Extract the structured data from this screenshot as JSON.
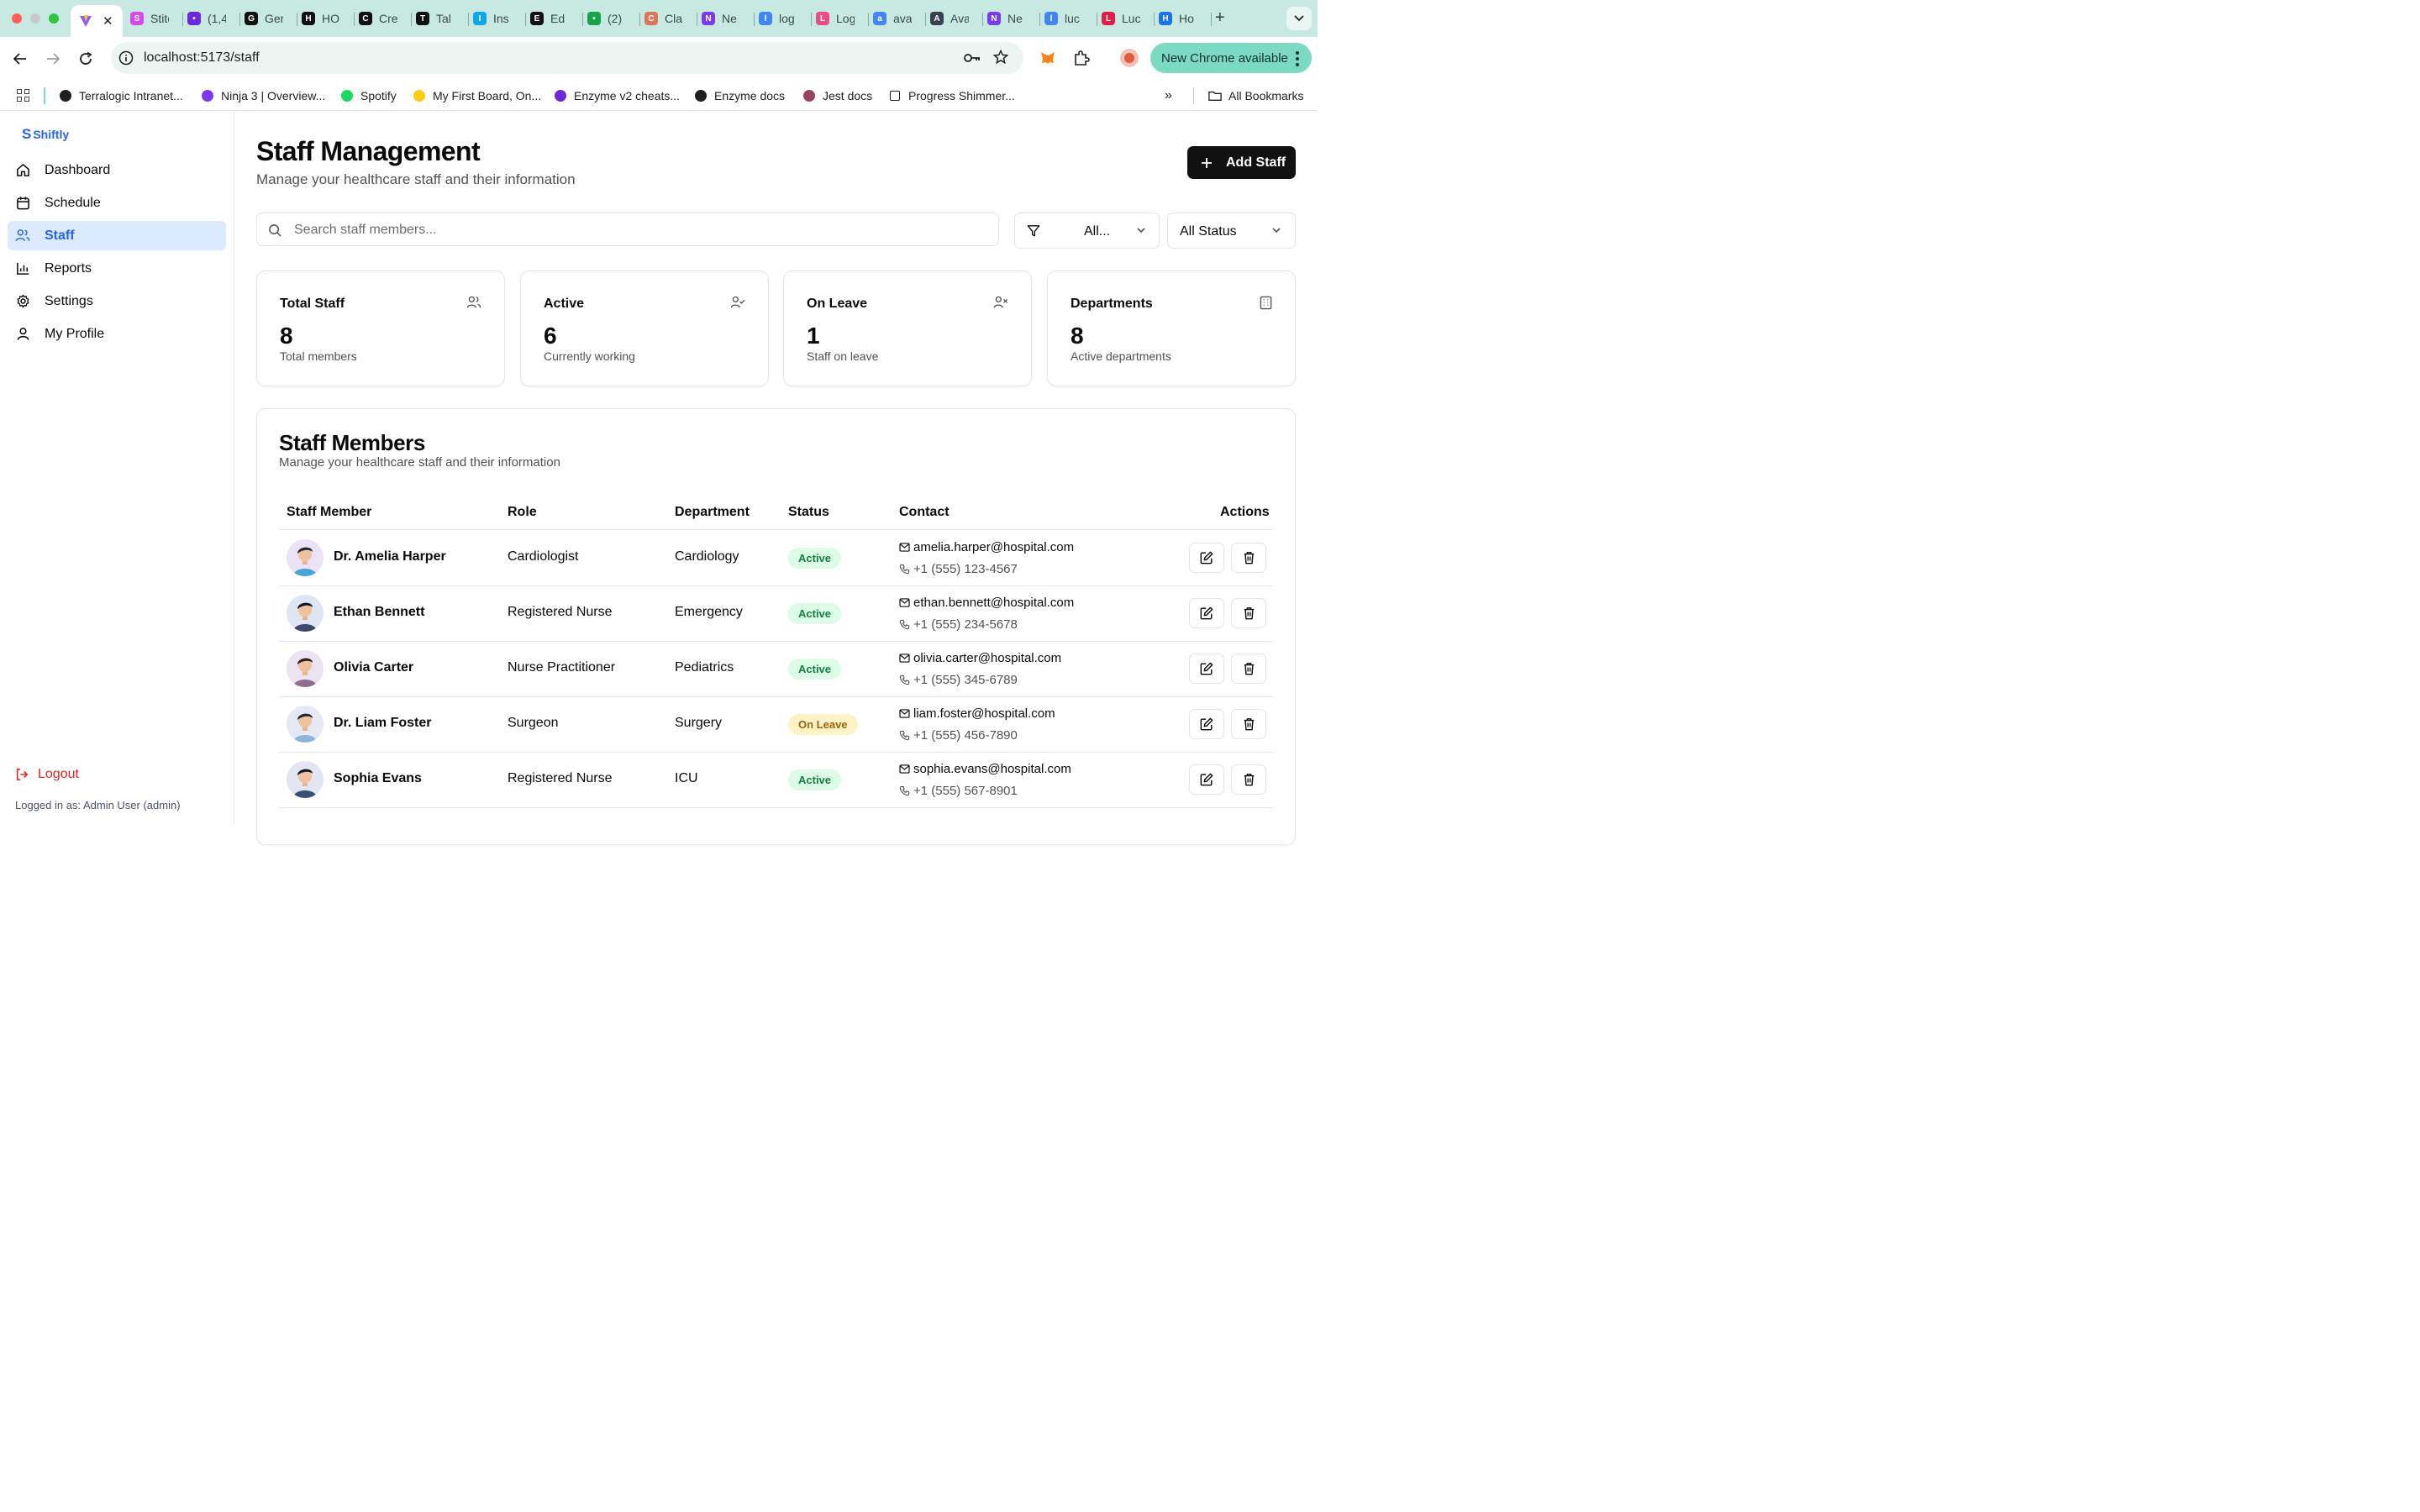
{
  "browser": {
    "tabs": [
      {
        "title": "",
        "icon": "vite-icon",
        "color": "#8b5cf6",
        "active": true
      },
      {
        "title": "Stitch",
        "icon": "flask-icon",
        "color": "#d946ef"
      },
      {
        "title": "(1,4",
        "icon": "mail-icon",
        "color": "#6d28d9"
      },
      {
        "title": "Gem",
        "icon": "notion-icon",
        "color": "#111111"
      },
      {
        "title": "HO",
        "icon": "openai-icon",
        "color": "#111111"
      },
      {
        "title": "Cre",
        "icon": "triangle-icon",
        "color": "#111111"
      },
      {
        "title": "Tal",
        "icon": "pen-icon",
        "color": "#111111"
      },
      {
        "title": "Ins",
        "icon": "wave-icon",
        "color": "#0ea5e9"
      },
      {
        "title": "Ed",
        "icon": "github-icon",
        "color": "#111111"
      },
      {
        "title": "(2)",
        "icon": "whatsapp-icon",
        "color": "#16a34a"
      },
      {
        "title": "Cla",
        "icon": "claude-icon",
        "color": "#d97757"
      },
      {
        "title": "Ne",
        "icon": "app-icon",
        "color": "#7c3aed"
      },
      {
        "title": "log",
        "icon": "google-icon",
        "color": "#4285f4"
      },
      {
        "title": "Log",
        "icon": "dribbble-icon",
        "color": "#ea4c89"
      },
      {
        "title": "ava",
        "icon": "google-icon",
        "color": "#4285f4"
      },
      {
        "title": "Ava",
        "icon": "avatar-icon",
        "color": "#374151"
      },
      {
        "title": "Ne",
        "icon": "app-icon",
        "color": "#7c3aed"
      },
      {
        "title": "luc",
        "icon": "google-icon",
        "color": "#4285f4"
      },
      {
        "title": "Luc",
        "icon": "spiral-icon",
        "color": "#e11d48"
      },
      {
        "title": "Ho",
        "icon": "drive-icon",
        "color": "#1a73e8"
      }
    ],
    "url": "localhost:5173/staff",
    "update_label": "New Chrome available",
    "bookmarks": [
      {
        "label": "Terralogic Intranet...",
        "icon": "globe-icon"
      },
      {
        "label": "Ninja 3 | Overview...",
        "icon": "ninja-icon"
      },
      {
        "label": "Spotify",
        "icon": "spotify-icon"
      },
      {
        "label": "My First Board, On...",
        "icon": "miro-icon"
      },
      {
        "label": "Enzyme v2 cheats...",
        "icon": "enzyme-icon"
      },
      {
        "label": "Enzyme docs",
        "icon": "book-icon"
      },
      {
        "label": "Jest docs",
        "icon": "jest-icon"
      },
      {
        "label": "Progress Shimmer...",
        "icon": "square-icon"
      }
    ],
    "all_bookmarks": "All Bookmarks"
  },
  "sidebar": {
    "brand": "Shiftly",
    "items": [
      {
        "label": "Dashboard",
        "icon": "home-icon"
      },
      {
        "label": "Schedule",
        "icon": "calendar-icon"
      },
      {
        "label": "Staff",
        "icon": "users-icon",
        "active": true
      },
      {
        "label": "Reports",
        "icon": "chart-icon"
      },
      {
        "label": "Settings",
        "icon": "gear-icon"
      },
      {
        "label": "My Profile",
        "icon": "user-icon"
      }
    ],
    "logout": "Logout",
    "logged_in": "Logged in as: Admin User (admin)"
  },
  "header": {
    "title": "Staff Management",
    "subtitle": "Manage your healthcare staff and their information",
    "add_button": "Add Staff"
  },
  "filters": {
    "search_placeholder": "Search staff members...",
    "department_value": "All...",
    "status_value": "All Status"
  },
  "stats": [
    {
      "label": "Total Staff",
      "value": "8",
      "sub": "Total members",
      "icon": "users-icon"
    },
    {
      "label": "Active",
      "value": "6",
      "sub": "Currently working",
      "icon": "user-check-icon"
    },
    {
      "label": "On Leave",
      "value": "1",
      "sub": "Staff on leave",
      "icon": "user-x-icon"
    },
    {
      "label": "Departments",
      "value": "8",
      "sub": "Active departments",
      "icon": "building-icon"
    }
  ],
  "members": {
    "title": "Staff Members",
    "subtitle": "Manage your healthcare staff and their information",
    "columns": [
      "Staff Member",
      "Role",
      "Department",
      "Status",
      "Contact",
      "Actions"
    ],
    "rows": [
      {
        "name": "Dr. Amelia Harper",
        "role": "Cardiologist",
        "department": "Cardiology",
        "status": "Active",
        "email": "amelia.harper@hospital.com",
        "phone": "+1 (555) 123-4567"
      },
      {
        "name": "Ethan Bennett",
        "role": "Registered Nurse",
        "department": "Emergency",
        "status": "Active",
        "email": "ethan.bennett@hospital.com",
        "phone": "+1 (555) 234-5678"
      },
      {
        "name": "Olivia Carter",
        "role": "Nurse Practitioner",
        "department": "Pediatrics",
        "status": "Active",
        "email": "olivia.carter@hospital.com",
        "phone": "+1 (555) 345-6789"
      },
      {
        "name": "Dr. Liam Foster",
        "role": "Surgeon",
        "department": "Surgery",
        "status": "On Leave",
        "email": "liam.foster@hospital.com",
        "phone": "+1 (555) 456-7890"
      },
      {
        "name": "Sophia Evans",
        "role": "Registered Nurse",
        "department": "ICU",
        "status": "Active",
        "email": "sophia.evans@hospital.com",
        "phone": "+1 (555) 567-8901"
      }
    ]
  },
  "colors": {
    "accent": "#2563eb",
    "active_badge_bg": "#dcfce7",
    "active_badge_fg": "#15803d",
    "leave_badge_bg": "#fef3c7",
    "leave_badge_fg": "#a16207",
    "danger": "#dc2626"
  }
}
